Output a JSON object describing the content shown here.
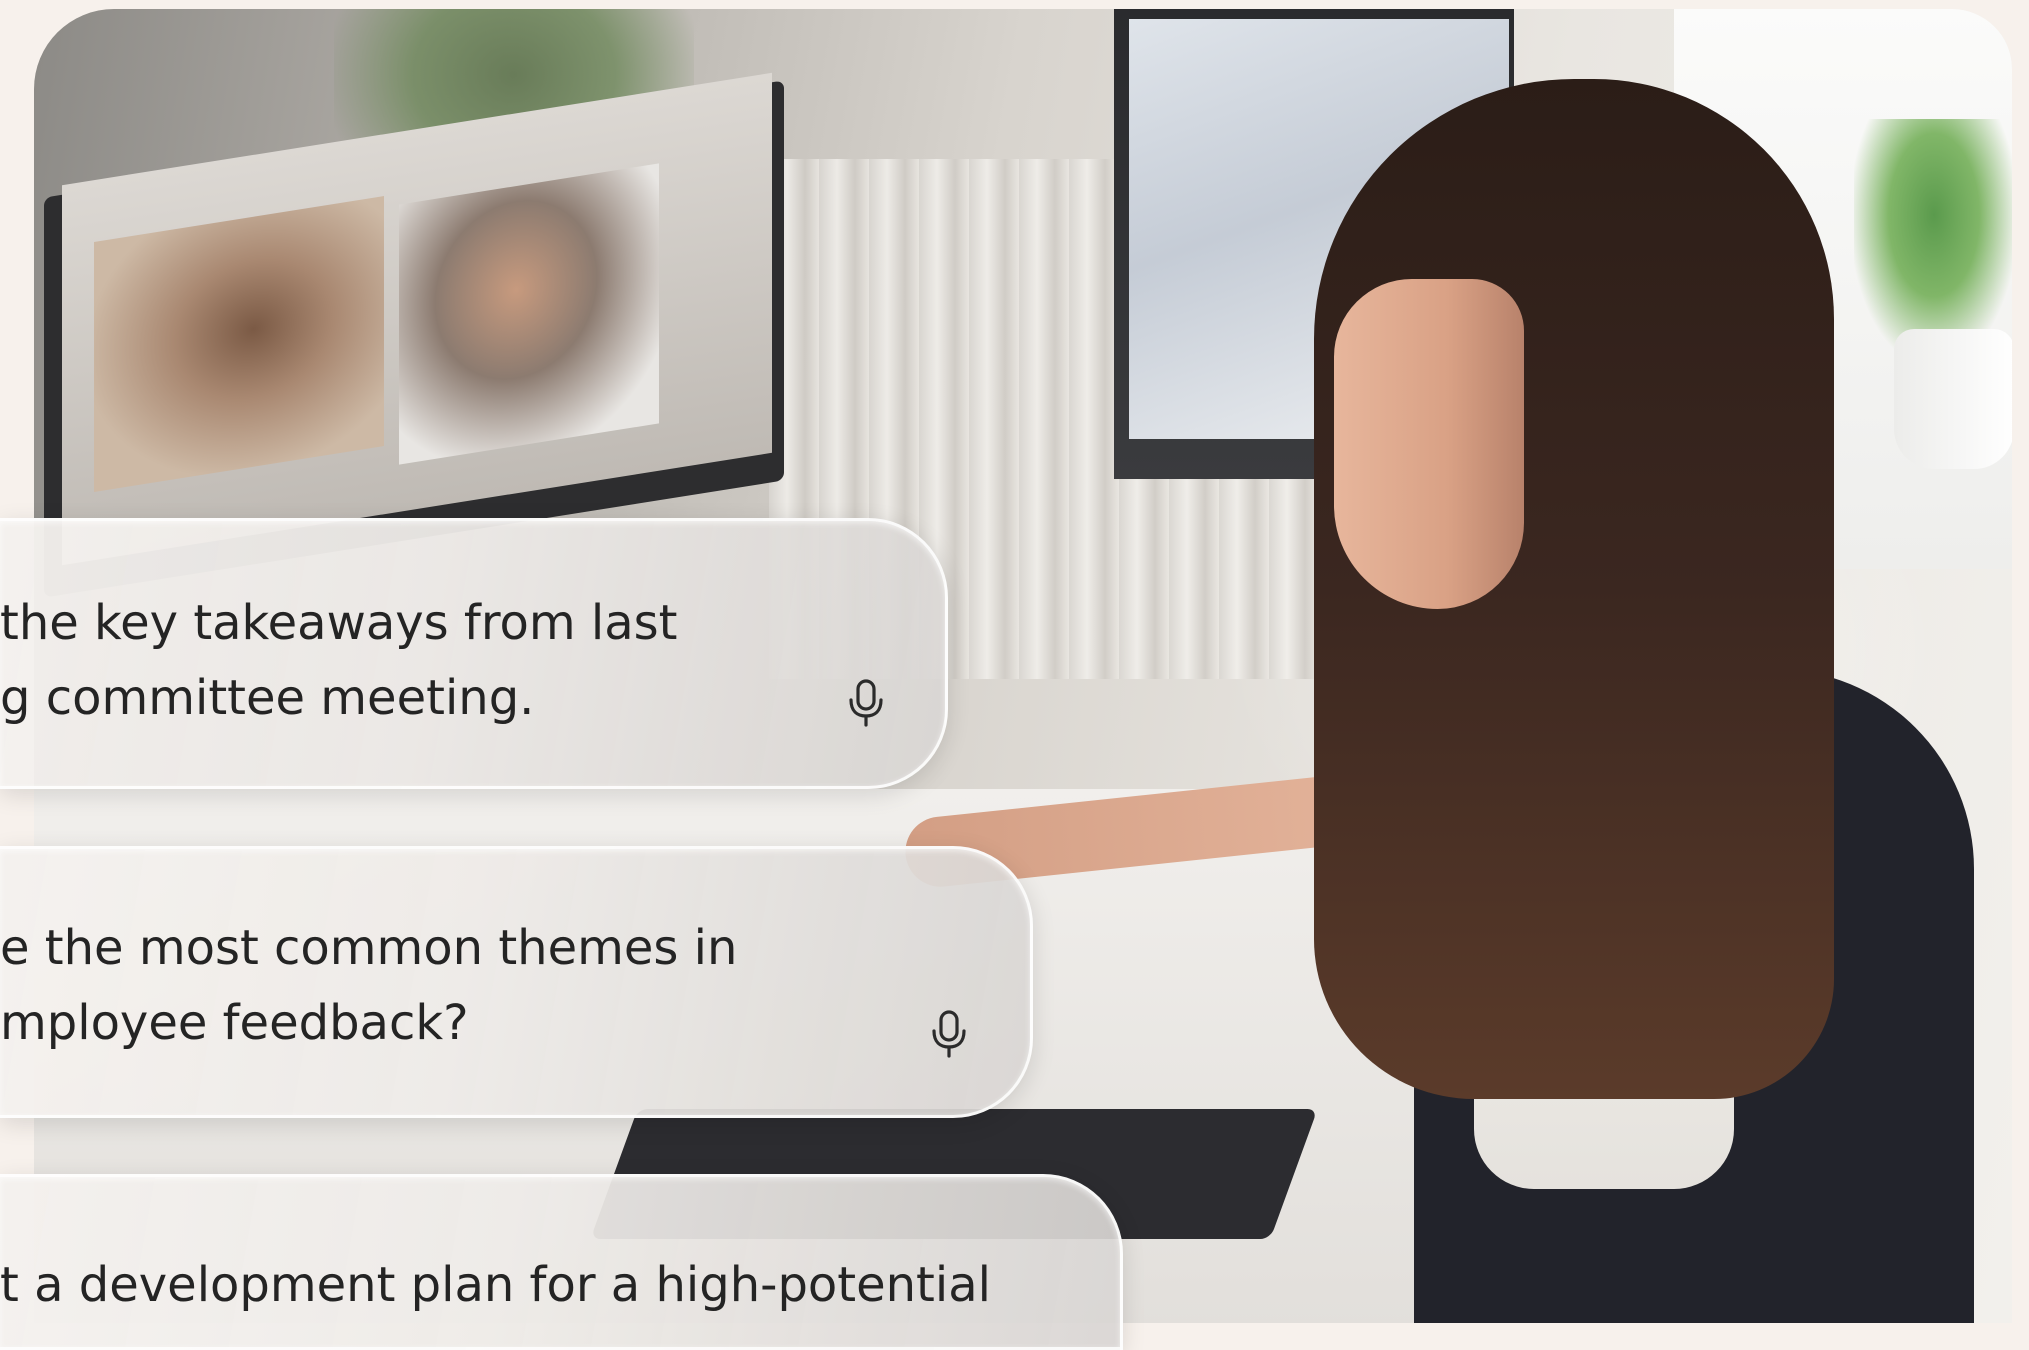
{
  "prompts": [
    {
      "line1": "the key takeaways from last",
      "line2": "g committee meeting.",
      "mic_icon": "microphone-icon"
    },
    {
      "line1": "e the most common themes in",
      "line2": "mployee feedback?",
      "mic_icon": "microphone-icon"
    },
    {
      "line1": "t a development plan for a high-potential"
    }
  ],
  "colors": {
    "page_background": "#f7f1ec",
    "text": "#242424"
  }
}
